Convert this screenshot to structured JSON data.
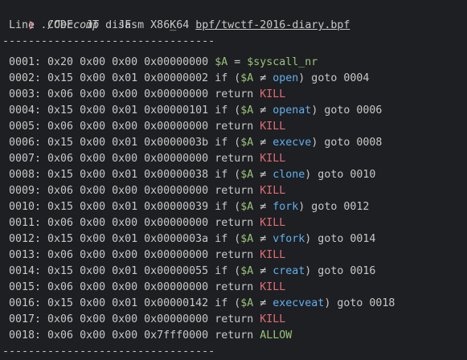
{
  "prompt": {
    "arrow": "❯",
    "program": "./Ceccomp",
    "args": "disasm X86_64",
    "file": "bpf/twctf-2016-diary.bpf"
  },
  "header": " Line  CODE  JT   JF      K",
  "separator": "---------------------------------",
  "rows": [
    {
      "prefix": " 0001: 0x20 0x00 0x00 0x00000000 ",
      "kind": "assign",
      "lhs": "$A",
      "eq": " = ",
      "rhs": "$syscall_nr"
    },
    {
      "prefix": " 0002: 0x15 0x00 0x01 0x00000002 ",
      "kind": "if",
      "name": "open",
      "target": "0004"
    },
    {
      "prefix": " 0003: 0x06 0x00 0x00 0x00000000 ",
      "kind": "return",
      "value": "KILL"
    },
    {
      "prefix": " 0004: 0x15 0x00 0x01 0x00000101 ",
      "kind": "if",
      "name": "openat",
      "target": "0006"
    },
    {
      "prefix": " 0005: 0x06 0x00 0x00 0x00000000 ",
      "kind": "return",
      "value": "KILL"
    },
    {
      "prefix": " 0006: 0x15 0x00 0x01 0x0000003b ",
      "kind": "if",
      "name": "execve",
      "target": "0008"
    },
    {
      "prefix": " 0007: 0x06 0x00 0x00 0x00000000 ",
      "kind": "return",
      "value": "KILL"
    },
    {
      "prefix": " 0008: 0x15 0x00 0x01 0x00000038 ",
      "kind": "if",
      "name": "clone",
      "target": "0010"
    },
    {
      "prefix": " 0009: 0x06 0x00 0x00 0x00000000 ",
      "kind": "return",
      "value": "KILL"
    },
    {
      "prefix": " 0010: 0x15 0x00 0x01 0x00000039 ",
      "kind": "if",
      "name": "fork",
      "target": "0012"
    },
    {
      "prefix": " 0011: 0x06 0x00 0x00 0x00000000 ",
      "kind": "return",
      "value": "KILL"
    },
    {
      "prefix": " 0012: 0x15 0x00 0x01 0x0000003a ",
      "kind": "if",
      "name": "vfork",
      "target": "0014"
    },
    {
      "prefix": " 0013: 0x06 0x00 0x00 0x00000000 ",
      "kind": "return",
      "value": "KILL"
    },
    {
      "prefix": " 0014: 0x15 0x00 0x01 0x00000055 ",
      "kind": "if",
      "name": "creat",
      "target": "0016"
    },
    {
      "prefix": " 0015: 0x06 0x00 0x00 0x00000000 ",
      "kind": "return",
      "value": "KILL"
    },
    {
      "prefix": " 0016: 0x15 0x00 0x01 0x00000142 ",
      "kind": "if",
      "name": "execveat",
      "target": "0018"
    },
    {
      "prefix": " 0017: 0x06 0x00 0x00 0x00000000 ",
      "kind": "return",
      "value": "KILL"
    },
    {
      "prefix": " 0018: 0x06 0x00 0x00 0x7fff0000 ",
      "kind": "return",
      "value": "ALLOW"
    }
  ],
  "tokens": {
    "if_kw": "if (",
    "var": "$A",
    "neq": " ≠ ",
    "close": ") goto ",
    "return_kw": "return "
  },
  "colors": {
    "background": "#1e1f22",
    "text": "#c8c8c8",
    "green": "#98c379",
    "red": "#e06c75",
    "blue": "#61afef"
  }
}
